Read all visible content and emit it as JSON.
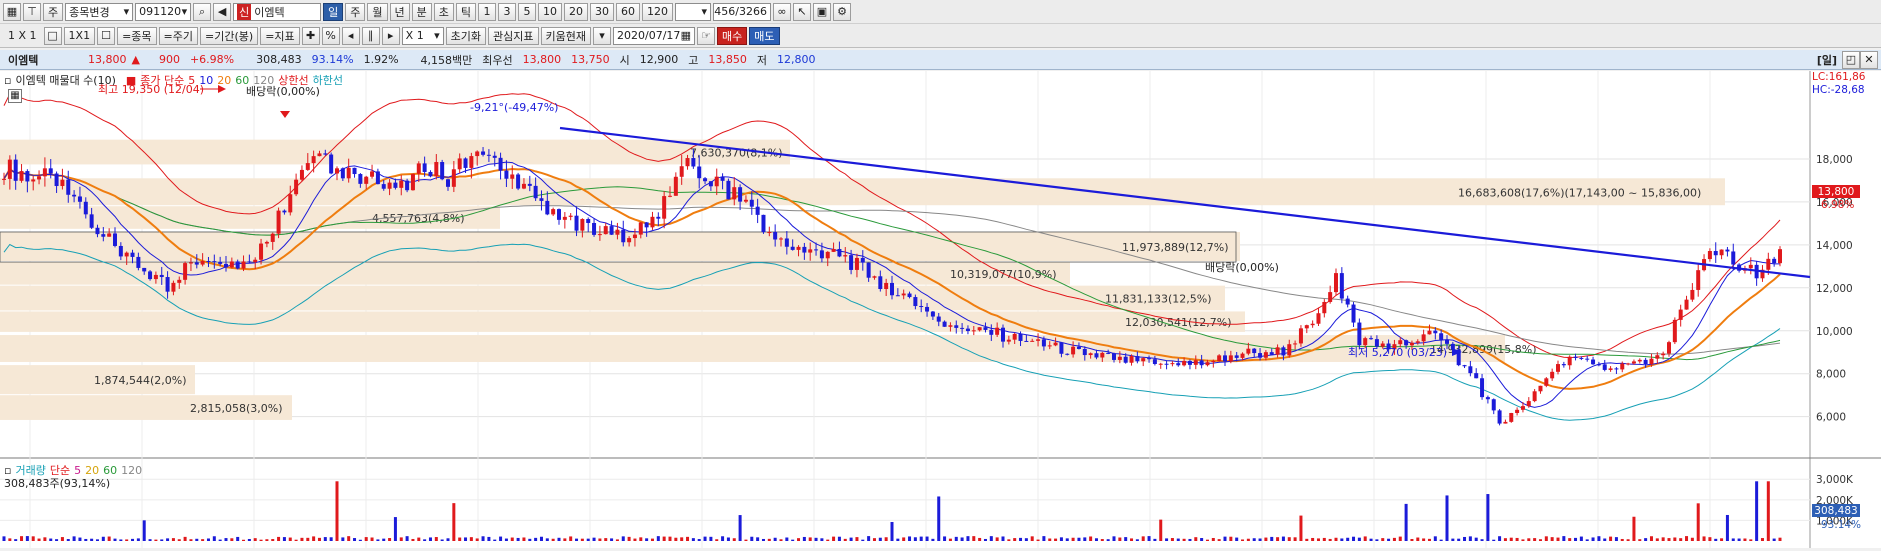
{
  "toolbar1": {
    "tabs": [
      "주"
    ],
    "market_selector": "종목변경",
    "code": "091120",
    "stock_name": "이엠텍",
    "period_buttons": [
      "일",
      "주",
      "월",
      "년",
      "분",
      "초",
      "틱"
    ],
    "active_period": "일",
    "minute_buttons": [
      "1",
      "3",
      "5",
      "10",
      "20",
      "30",
      "60",
      "120"
    ],
    "page_counter": "456/3266"
  },
  "toolbar2": {
    "mode_labels": [
      "1 X 1",
      "1X1"
    ],
    "stock_same": "=종목",
    "period_same": "=주기",
    "range_same": "=기간(봉)",
    "indicator_same": "=지표",
    "zoom_label": "X 1",
    "reset": "초기화",
    "favorites": "관심지표",
    "kium": "키움현재",
    "date": "2020/07/17",
    "buy": "매수",
    "sell": "매도"
  },
  "quote": {
    "name": "이엠텍",
    "price": "13,800",
    "change": "900",
    "change_pct": "+6.98%",
    "volume": "308,483",
    "vol_ratio": "93.14%",
    "turnover": "1.92%",
    "amount": "4,158백만",
    "best_label": "최우선",
    "ask": "13,800",
    "bid": "13,750",
    "open_label": "시",
    "open": "12,900",
    "high_label": "고",
    "high": "13,850",
    "low_label": "저",
    "low": "12,800",
    "right_label": "[일]"
  },
  "price_legend": {
    "title": "이엠텍 매물대 수(10)",
    "ma_label": "종가 단순",
    "periods": [
      "5",
      "10",
      "20",
      "60",
      "120"
    ],
    "upper": "상한선",
    "lower": "하한선"
  },
  "volume_legend": {
    "title": "거래량",
    "ma_label": "단순",
    "periods": [
      "5",
      "20",
      "60",
      "120"
    ],
    "info": "308,483주(93,14%)"
  },
  "annotations": {
    "high": "최고 19,350 (12/04)",
    "dividend": "배당락(0,00%)",
    "trend": "-9,21°(-49,47%)",
    "low": "최저 5,270 (03/23)",
    "dividend2": "배당락(0,00%)",
    "lc": "LC:161,86",
    "hc": "HC:-28,68"
  },
  "volume_profile": [
    {
      "label": "7,630,370(8,1%)"
    },
    {
      "label": "16,683,608(17,6%)(17,143,00 ~ 15,836,00)"
    },
    {
      "label": "4,557,763(4,8%)"
    },
    {
      "label": "11,973,889(12,7%)"
    },
    {
      "label": "10,319,077(10,9%)"
    },
    {
      "label": "11,831,133(12,5%)"
    },
    {
      "label": "12,030,541(12,7%)"
    },
    {
      "label": "14,932,899(15,8%)"
    },
    {
      "label": "1,874,544(2,0%)"
    },
    {
      "label": "2,815,058(3,0%)"
    }
  ],
  "price_axis": [
    "18,000",
    "16,000",
    "14,000",
    "12,000",
    "10,000",
    "8,000",
    "6,000"
  ],
  "price_tags": {
    "current": "13,800",
    "pct": "6.98%"
  },
  "volume_axis": [
    "3,000K",
    "2,000K",
    "1,000K"
  ],
  "volume_tags": {
    "current": "308,483",
    "pct": "93.14%"
  },
  "chart_data": {
    "type": "candlestick",
    "title": "이엠텍",
    "ylim": [
      4400,
      20700
    ],
    "volume_ylim": [
      0,
      3400000
    ],
    "close_series": [
      17600,
      17300,
      17000,
      16200,
      14800,
      13400,
      12800,
      12100,
      13200,
      13600,
      13000,
      13900,
      15900,
      18200,
      17800,
      16900,
      17300,
      16500,
      17600,
      17200,
      18200,
      17600,
      16600,
      16000,
      15300,
      14900,
      14300,
      14800,
      15400,
      17800,
      17200,
      16500,
      15800,
      14200,
      13800,
      13500,
      13400,
      12600,
      12000,
      11300,
      10500,
      10200,
      10000,
      9700,
      9400,
      9200,
      9000,
      8800,
      8600,
      8500,
      8400,
      8500,
      8700,
      9000,
      8800,
      9200,
      10500,
      12500,
      9600,
      9200,
      9400,
      9800,
      9000,
      7600,
      5700,
      6500,
      7800,
      8700,
      8400,
      8200,
      8500,
      8900,
      11600,
      13600,
      13300,
      12600,
      13800
    ]
  }
}
